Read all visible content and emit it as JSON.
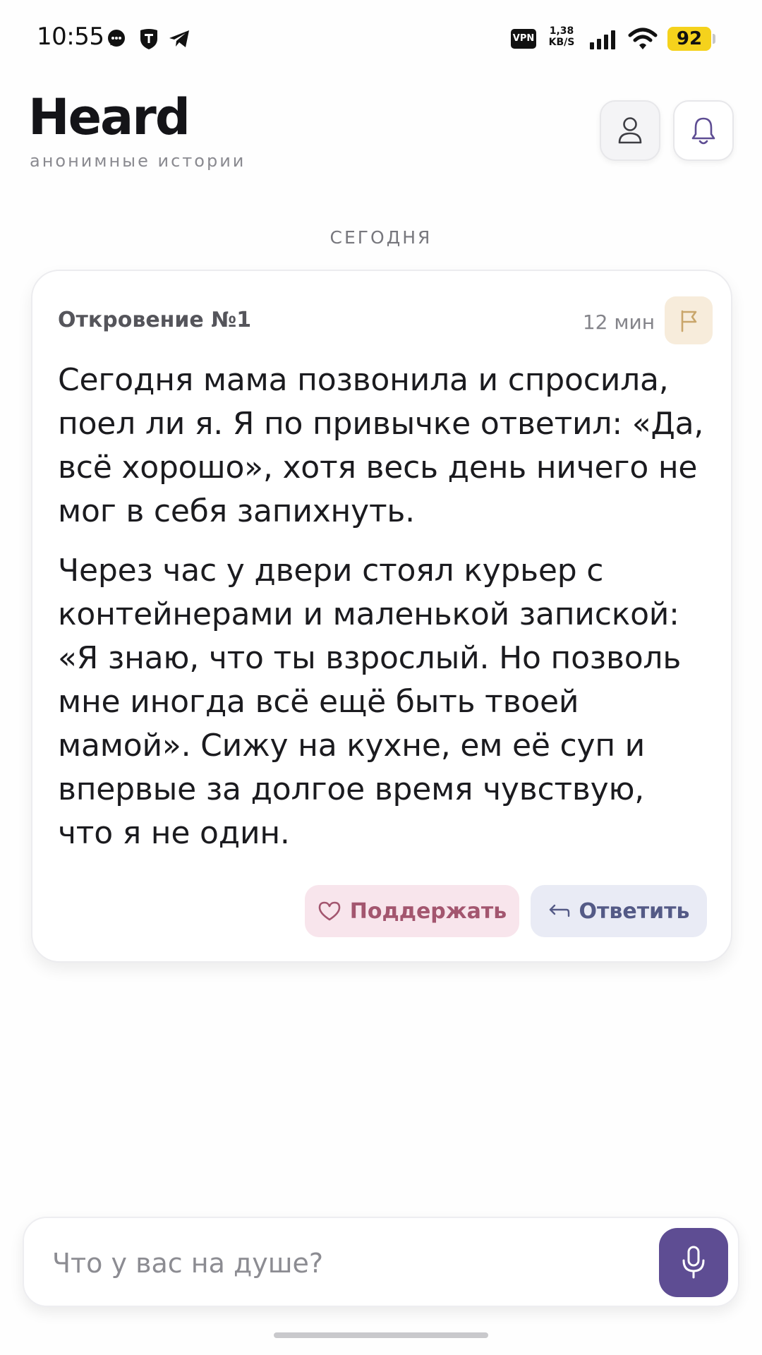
{
  "status_bar": {
    "time": "10:55",
    "vpn_label": "VPN",
    "speed_value": "1,38",
    "speed_unit": "KB/S",
    "battery": "92",
    "icons": [
      "chat-bubble-icon",
      "shield-t-icon",
      "telegram-icon",
      "signal-icon",
      "wifi-icon"
    ]
  },
  "header": {
    "title": "Heard",
    "subtitle": "анонимные истории",
    "profile_icon": "user-icon",
    "notifications_icon": "bell-icon"
  },
  "feed": {
    "date_label": "СЕГОДНЯ"
  },
  "story_card": {
    "title": "Откровение №1",
    "time": "12 мин",
    "flag_icon": "flag-icon",
    "paragraphs": [
      "Сегодня мама позвонила и спросила, поел ли я. Я по привычке ответил: «Да, всё хорошо», хотя весь день ничего не мог в себя запихнуть.",
      "Через час у двери стоял курьер с контейнерами и маленькой запиской: «Я знаю, что ты взрослый. Но позволь мне иногда всё ещё быть твоей мамой». Сижу на кухне, ем её суп и впервые за долгое время чувствую, что я не один."
    ],
    "support_label": "Поддержать",
    "reply_label": "Ответить",
    "support_icon": "heart-icon",
    "reply_icon": "reply-arrow-icon"
  },
  "composer": {
    "placeholder": "Что у вас на душе?",
    "value": "",
    "mic_icon": "microphone-icon"
  },
  "colors": {
    "accent": "#5e4d93",
    "support_bg": "#f8e5ec",
    "support_text": "#a3566f",
    "reply_bg": "#e9ebf5",
    "reply_text": "#545a86",
    "flag_bg": "#f7ecdb",
    "battery": "#f5d21c"
  }
}
